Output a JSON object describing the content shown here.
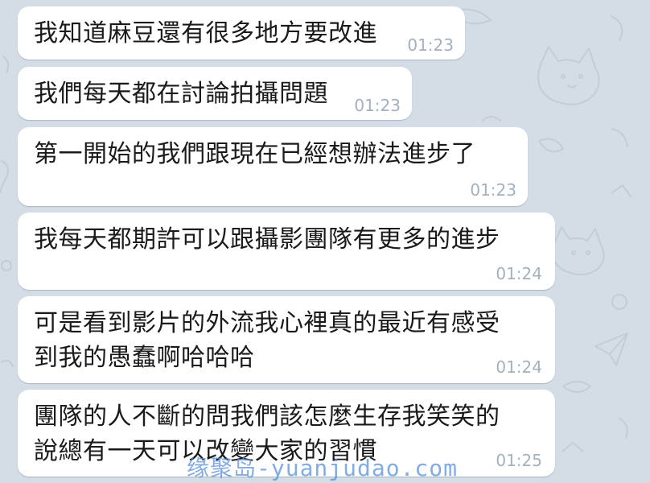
{
  "theme": {
    "background": "#d4dde6",
    "bubble": "#ffffff",
    "timestamp": "#a3b1bf",
    "watermark": "#5a8fdc"
  },
  "messages": [
    {
      "text": "我知道麻豆還有很多地方要改進",
      "time": "01:23"
    },
    {
      "text": "我們每天都在討論拍攝問題",
      "time": "01:23"
    },
    {
      "text": "第一開始的我們跟現在已經想辦法進步了",
      "time": "01:23"
    },
    {
      "text": "我每天都期許可以跟攝影團隊有更多的進步",
      "time": "01:24"
    },
    {
      "lines": [
        "可是看到影片的外流我心裡真的最近有感受",
        "到我的愚蠢啊哈哈哈"
      ],
      "time": "01:24"
    },
    {
      "lines": [
        "團隊的人不斷的問我們該怎麼生存我笑笑的",
        "說總有一天可以改變大家的習慣"
      ],
      "time": "01:25"
    }
  ],
  "watermark": "缘聚岛-yuanjudao.com"
}
